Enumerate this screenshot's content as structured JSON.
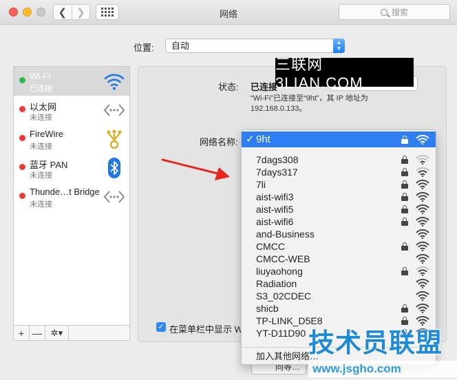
{
  "window": {
    "title": "网络",
    "search_placeholder": "搜索"
  },
  "location": {
    "label": "位置:",
    "value": "自动"
  },
  "services": [
    {
      "name": "Wi-Fi",
      "status": "已连接",
      "dot_color": "#2db84a",
      "icon": "wifi-icon",
      "selected": true
    },
    {
      "name": "以太网",
      "status": "未连接",
      "dot_color": "#ec3b34",
      "icon": "ethernet-icon"
    },
    {
      "name": "FireWire",
      "status": "未连接",
      "dot_color": "#ec3b34",
      "icon": "firewire-icon"
    },
    {
      "name": "蓝牙 PAN",
      "status": "未连接",
      "dot_color": "#ec3b34",
      "icon": "bluetooth-icon"
    },
    {
      "name": "Thunde…t Bridge",
      "status": "未连接",
      "dot_color": "#ec3b34",
      "icon": "thunderbolt-bridge-icon"
    }
  ],
  "sidebar_toolbar": {
    "add": "+",
    "remove": "—",
    "gear": "✲▾"
  },
  "detail": {
    "status_label": "状态:",
    "status_value": "已连接",
    "status_desc": "“Wi-Fi”已连接至“9ht”，其 IP 地址为 192.168.0.133。",
    "network_name_label": "网络名称:",
    "show_in_menubar": "在菜单栏中显示 Wi",
    "sync_button": "同等…"
  },
  "network_menu": {
    "selected": {
      "name": "9ht",
      "check": "✓",
      "locked": true,
      "signal": 3
    },
    "items": [
      {
        "name": "7dags308",
        "locked": true,
        "signal": 1
      },
      {
        "name": "7days317",
        "locked": true,
        "signal": 2
      },
      {
        "name": "7li",
        "locked": true,
        "signal": 3
      },
      {
        "name": "aist-wifi3",
        "locked": true,
        "signal": 3
      },
      {
        "name": "aist-wifi5",
        "locked": true,
        "signal": 3
      },
      {
        "name": "aist-wifi6",
        "locked": true,
        "signal": 3
      },
      {
        "name": "and-Business",
        "locked": false,
        "signal": 3
      },
      {
        "name": "CMCC",
        "locked": true,
        "signal": 3
      },
      {
        "name": "CMCC-WEB",
        "locked": false,
        "signal": 3
      },
      {
        "name": "liuyaohong",
        "locked": true,
        "signal": 2
      },
      {
        "name": "Radiation",
        "locked": false,
        "signal": 3
      },
      {
        "name": "S3_02CDEC",
        "locked": false,
        "signal": 3
      },
      {
        "name": "shicb",
        "locked": true,
        "signal": 3
      },
      {
        "name": "TP-LINK_D5E8",
        "locked": true,
        "signal": 3
      },
      {
        "name": "YT-D11D90",
        "locked": true,
        "signal": 3
      }
    ],
    "other": "加入其他网络…"
  },
  "watermarks": {
    "top": "三联网 3LIAN.COM",
    "bottom_title": "技术员联盟",
    "bottom_url": "www.jsgho.com"
  },
  "colors": {
    "accent": "#2d7ef3",
    "connected": "#2db84a",
    "disconnected": "#ec3b34",
    "arrow": "#e8261d"
  }
}
